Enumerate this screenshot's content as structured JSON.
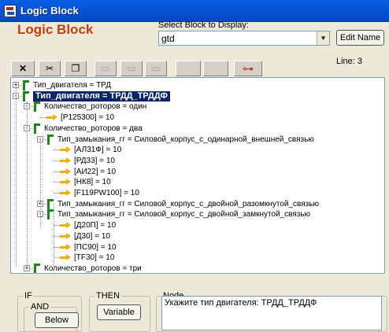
{
  "window": {
    "title": "Logic Block",
    "app_icon": "logic-block-app-icon"
  },
  "header": {
    "heading": "Logic Block",
    "select_label": "Select Block to Display:",
    "select_value": "gtd",
    "edit_name_label": "Edit Name"
  },
  "toolbar": {
    "buttons": [
      {
        "name": "delete",
        "glyph": "✕",
        "enabled": true
      },
      {
        "name": "cut",
        "glyph": "✂",
        "enabled": true
      },
      {
        "name": "copy",
        "glyph": "❐",
        "enabled": true
      },
      {
        "name": "paste-1",
        "glyph": "▭",
        "enabled": false
      },
      {
        "name": "paste-2",
        "glyph": "▭",
        "enabled": false
      },
      {
        "name": "paste-3",
        "glyph": "▭",
        "enabled": false
      },
      {
        "name": "blank-1",
        "glyph": "",
        "enabled": false
      },
      {
        "name": "blank-2",
        "glyph": "",
        "enabled": false
      },
      {
        "name": "tree-view",
        "glyph": "⊶",
        "enabled": true
      }
    ],
    "line_status": "Line: 3"
  },
  "tree": {
    "nodes": [
      {
        "text": "Тип_двигателя = ТРД",
        "kind": "condition",
        "level": 0,
        "expander": "+"
      },
      {
        "text": "Тип_двигателя = ТРДД_ТРДДФ",
        "kind": "condition",
        "level": 0,
        "expander": "-",
        "selected": true
      },
      {
        "text": "Количество_роторов = один",
        "kind": "condition",
        "level": 1,
        "expander": "-"
      },
      {
        "text": "[P125300] = 10",
        "kind": "action",
        "level": 2
      },
      {
        "text": "Количество_роторов = два",
        "kind": "condition",
        "level": 1,
        "expander": "-"
      },
      {
        "text": "Тип_замыкания_гг = Силовой_корпус_с_одинарной_внешней_связью",
        "kind": "condition",
        "level": 2,
        "expander": "-"
      },
      {
        "text": "[АЛ31Ф] = 10",
        "kind": "action",
        "level": 3
      },
      {
        "text": "[РД33] = 10",
        "kind": "action",
        "level": 3
      },
      {
        "text": "[АИ22] = 10",
        "kind": "action",
        "level": 3
      },
      {
        "text": "[НК8] = 10",
        "kind": "action",
        "level": 3
      },
      {
        "text": "[F119PW100] = 10",
        "kind": "action",
        "level": 3
      },
      {
        "text": "Тип_замыкания_гг = Силовой_корпус_с_двойной_разомкнутой_связью",
        "kind": "condition",
        "level": 2,
        "expander": "+"
      },
      {
        "text": "Тип_замыкания_гг = Силовой_корпус_с_двойной_замкнутой_связью",
        "kind": "condition",
        "level": 2,
        "expander": "-"
      },
      {
        "text": "[Д20П] = 10",
        "kind": "action",
        "level": 3
      },
      {
        "text": "[Д30] = 10",
        "kind": "action",
        "level": 3
      },
      {
        "text": "[ПС90] = 10",
        "kind": "action",
        "level": 3
      },
      {
        "text": "[TF30] = 10",
        "kind": "action",
        "level": 3
      },
      {
        "text": "Количество_роторов = три",
        "kind": "condition",
        "level": 1,
        "expander": "+"
      }
    ]
  },
  "bottom": {
    "if_label": "IF",
    "and_label": "AND",
    "below_label": "Below",
    "then_label": "THEN",
    "variable_label": "Variable",
    "node_label": "Node",
    "node_text": "Укажите тип двигателя: ТРДД_ТРДДФ"
  }
}
